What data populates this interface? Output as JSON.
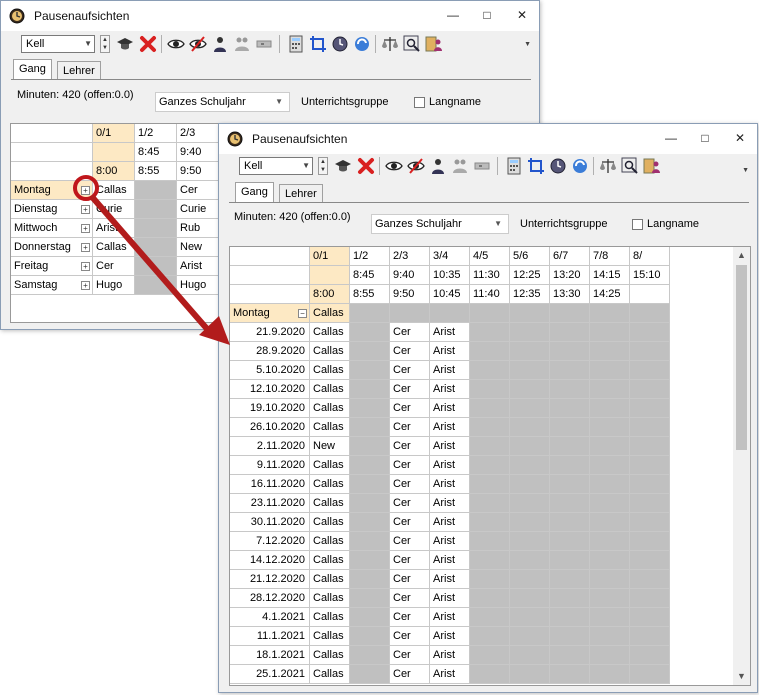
{
  "back_window": {
    "title": "Pausenaufsichten",
    "toolbar": {
      "teacher_value": "Kell"
    },
    "tabs": [
      "Gang",
      "Lehrer"
    ],
    "minutes_label": "Minuten: 420 (offen:0.0)",
    "period_select": "Ganzes Schuljahr",
    "group_label": "Unterrichtsgruppe",
    "longname_label": "Langname",
    "header_slots": [
      "0/1",
      "1/2",
      "2/3"
    ],
    "header_start": [
      "",
      "8:45",
      "9:40"
    ],
    "header_end": [
      "8:00",
      "8:55",
      "9:50"
    ],
    "rows": [
      {
        "day": "Montag",
        "cells": [
          "Callas",
          "",
          "Cer"
        ]
      },
      {
        "day": "Dienstag",
        "cells": [
          "Curie",
          "",
          "Curie"
        ]
      },
      {
        "day": "Mittwoch",
        "cells": [
          "Arist",
          "",
          "Rub"
        ]
      },
      {
        "day": "Donnerstag",
        "cells": [
          "Callas",
          "",
          "New"
        ]
      },
      {
        "day": "Freitag",
        "cells": [
          "Cer",
          "",
          "Arist"
        ]
      },
      {
        "day": "Samstag",
        "cells": [
          "Hugo",
          "",
          "Hugo"
        ]
      }
    ]
  },
  "front_window": {
    "title": "Pausenaufsichten",
    "toolbar": {
      "teacher_value": "Kell"
    },
    "tabs": [
      "Gang",
      "Lehrer"
    ],
    "minutes_label": "Minuten: 420 (offen:0.0)",
    "period_select": "Ganzes Schuljahr",
    "group_label": "Unterrichtsgruppe",
    "longname_label": "Langname",
    "header_slots": [
      "0/1",
      "1/2",
      "2/3",
      "3/4",
      "4/5",
      "5/6",
      "6/7",
      "7/8",
      "8/"
    ],
    "header_start": [
      "",
      "8:45",
      "9:40",
      "10:35",
      "11:30",
      "12:25",
      "13:20",
      "14:15",
      "15:10"
    ],
    "header_end": [
      "8:00",
      "8:55",
      "9:50",
      "10:45",
      "11:40",
      "12:35",
      "13:30",
      "14:25",
      ""
    ],
    "group_row": {
      "day": "Montag",
      "value": "Callas"
    },
    "rows": [
      {
        "date": "21.9.2020",
        "slot0": "Callas",
        "slot2": "Cer",
        "slot3": "Arist"
      },
      {
        "date": "28.9.2020",
        "slot0": "Callas",
        "slot2": "Cer",
        "slot3": "Arist"
      },
      {
        "date": "5.10.2020",
        "slot0": "Callas",
        "slot2": "Cer",
        "slot3": "Arist"
      },
      {
        "date": "12.10.2020",
        "slot0": "Callas",
        "slot2": "Cer",
        "slot3": "Arist"
      },
      {
        "date": "19.10.2020",
        "slot0": "Callas",
        "slot2": "Cer",
        "slot3": "Arist"
      },
      {
        "date": "26.10.2020",
        "slot0": "Callas",
        "slot2": "Cer",
        "slot3": "Arist"
      },
      {
        "date": "2.11.2020",
        "slot0": "New",
        "slot2": "Cer",
        "slot3": "Arist"
      },
      {
        "date": "9.11.2020",
        "slot0": "Callas",
        "slot2": "Cer",
        "slot3": "Arist"
      },
      {
        "date": "16.11.2020",
        "slot0": "Callas",
        "slot2": "Cer",
        "slot3": "Arist"
      },
      {
        "date": "23.11.2020",
        "slot0": "Callas",
        "slot2": "Cer",
        "slot3": "Arist"
      },
      {
        "date": "30.11.2020",
        "slot0": "Callas",
        "slot2": "Cer",
        "slot3": "Arist"
      },
      {
        "date": "7.12.2020",
        "slot0": "Callas",
        "slot2": "Cer",
        "slot3": "Arist"
      },
      {
        "date": "14.12.2020",
        "slot0": "Callas",
        "slot2": "Cer",
        "slot3": "Arist"
      },
      {
        "date": "21.12.2020",
        "slot0": "Callas",
        "slot2": "Cer",
        "slot3": "Arist"
      },
      {
        "date": "28.12.2020",
        "slot0": "Callas",
        "slot2": "Cer",
        "slot3": "Arist"
      },
      {
        "date": "4.1.2021",
        "slot0": "Callas",
        "slot2": "Cer",
        "slot3": "Arist"
      },
      {
        "date": "11.1.2021",
        "slot0": "Callas",
        "slot2": "Cer",
        "slot3": "Arist"
      },
      {
        "date": "18.1.2021",
        "slot0": "Callas",
        "slot2": "Cer",
        "slot3": "Arist"
      },
      {
        "date": "25.1.2021",
        "slot0": "Callas",
        "slot2": "Cer",
        "slot3": "Arist"
      }
    ]
  },
  "colors": {
    "highlight_ring": "#c0161b",
    "arrow": "#b21c1c",
    "slot_header": "#fde9c4",
    "empty_cell": "#c0c0c0"
  },
  "icons": [
    "clock-icon",
    "graduation-cap-icon",
    "delete-x-icon",
    "eye-icon",
    "eye-crossed-icon",
    "teacher-icon",
    "people-icon",
    "settings-icon",
    "calculator-icon",
    "crop-icon",
    "clock-circle-icon",
    "refresh-icon",
    "scales-icon",
    "search-zoom-icon",
    "book-person-icon"
  ]
}
